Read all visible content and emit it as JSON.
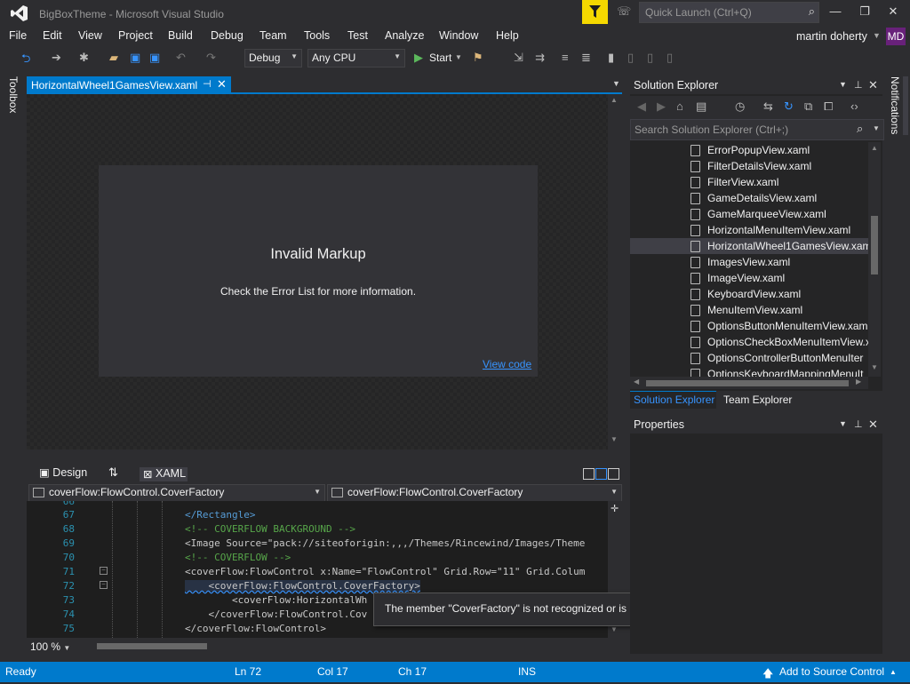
{
  "window": {
    "title": "BigBoxTheme - Microsoft Visual Studio",
    "quick_launch_placeholder": "Quick Launch (Ctrl+Q)",
    "user_name": "martin doherty",
    "user_initials": "MD",
    "avatar_color": "#68217a"
  },
  "menu": [
    "File",
    "Edit",
    "View",
    "Project",
    "Build",
    "Debug",
    "Team",
    "Tools",
    "Test",
    "Analyze",
    "Window",
    "Help"
  ],
  "toolbar": {
    "config": "Debug",
    "platform": "Any CPU",
    "start_label": "Start"
  },
  "left_strip": {
    "toolbox_label": "Toolbox"
  },
  "document": {
    "tab_label": "HorizontalWheel1GamesView.xaml",
    "invalid_title": "Invalid Markup",
    "invalid_sub": "Check the Error List for more information.",
    "view_code": "View code"
  },
  "pane_tabs": {
    "design": "Design",
    "xaml": "XAML"
  },
  "nav": {
    "left": "coverFlow:FlowControl.CoverFactory",
    "right": "coverFlow:FlowControl.CoverFactory"
  },
  "code_lines": [
    {
      "n": "66",
      "text": ""
    },
    {
      "n": "67",
      "text": "</Rectangle>"
    },
    {
      "n": "68",
      "text": "<!-- COVERFLOW BACKGROUND -->"
    },
    {
      "n": "69",
      "text": "<Image Source=\"pack://siteoforigin:,,,/Themes/Rincewind/Images/Theme"
    },
    {
      "n": "70",
      "text": "<!-- COVERFLOW -->"
    },
    {
      "n": "71",
      "text": "<coverFlow:FlowControl x:Name=\"FlowControl\" Grid.Row=\"11\" Grid.Colum"
    },
    {
      "n": "72",
      "text": "    <coverFlow:FlowControl.CoverFactory>"
    },
    {
      "n": "73",
      "text": "        <coverFlow:HorizontalWh"
    },
    {
      "n": "74",
      "text": "    </coverFlow:FlowControl.Cov"
    },
    {
      "n": "75",
      "text": "</coverFlow:FlowControl>"
    }
  ],
  "zoom": "100 %",
  "tooltip": "The member \"CoverFactory\" is not recognized or is not accessible.",
  "solution_explorer": {
    "title": "Solution Explorer",
    "search_placeholder": "Search Solution Explorer (Ctrl+;)",
    "items": [
      "ErrorPopupView.xaml",
      "FilterDetailsView.xaml",
      "FilterView.xaml",
      "GameDetailsView.xaml",
      "GameMarqueeView.xaml",
      "HorizontalMenuItemView.xaml",
      "HorizontalWheel1GamesView.xam",
      "ImagesView.xaml",
      "ImageView.xaml",
      "KeyboardView.xaml",
      "MenuItemView.xaml",
      "OptionsButtonMenuItemView.xam",
      "OptionsCheckBoxMenuItemView.x",
      "OptionsControllerButtonMenuIter",
      "OptionsKeyboardMappingMenuIt"
    ],
    "tab_solution": "Solution Explorer",
    "tab_team": "Team Explorer"
  },
  "properties": {
    "title": "Properties"
  },
  "notifications_label": "Notifications",
  "status": {
    "ready": "Ready",
    "ln": "Ln 72",
    "col": "Col 17",
    "ch": "Ch 17",
    "ins": "INS",
    "source_control": "Add to Source Control"
  },
  "colors": {
    "accent": "#007acc",
    "notify_flag": "#f5d800",
    "link": "#3794ff"
  }
}
